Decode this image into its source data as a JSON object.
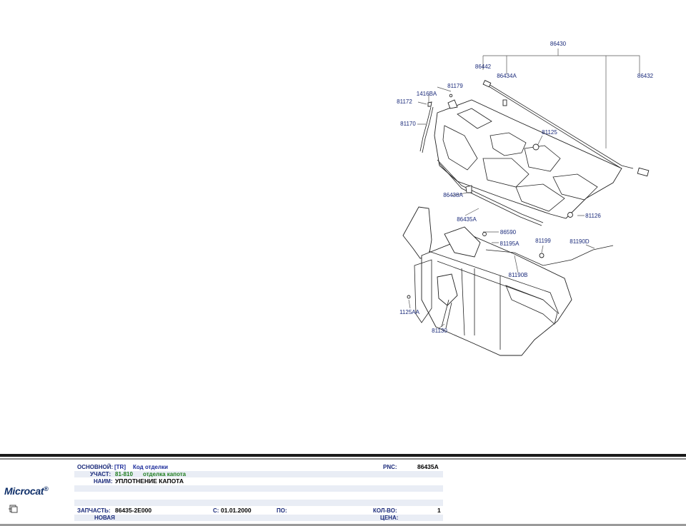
{
  "diagram": {
    "callouts": [
      "86430",
      "86442",
      "86434A",
      "86432",
      "81179",
      "1416BA",
      "81172",
      "81170",
      "81125",
      "86438A",
      "86435A",
      "81126",
      "86590",
      "81195A",
      "81199",
      "81190D",
      "81190B",
      "1125AA",
      "81130"
    ]
  },
  "info": {
    "app_logo": "Microcat",
    "base_label": "ОСНОВНОЙ:",
    "base_code": "[TR]",
    "base_value": "Код отделки",
    "pnc_label": "PNC:",
    "pnc_value": "86435A",
    "section_label": "УЧАСТ:",
    "section_code": "81-810",
    "section_value": "отделка капота",
    "name_label": "НАИМ:",
    "name_value": "УПЛОТНЕНИЕ КАПОТА",
    "part_label": "ЗАПЧАСТЬ:",
    "part_value": "86435-2E000",
    "from_label": "С:",
    "from_value": "01.01.2000",
    "to_label": "ПО:",
    "to_value": "",
    "qty_label": "КОЛ-ВО:",
    "qty_value": "1",
    "status_value": "НОВАЯ",
    "price_label": "ЦЕНА:",
    "price_value": ""
  },
  "colors": {
    "label_blue": "#1a2a7a",
    "section_green": "#1f7d1f",
    "logo_blue": "#10306a"
  }
}
